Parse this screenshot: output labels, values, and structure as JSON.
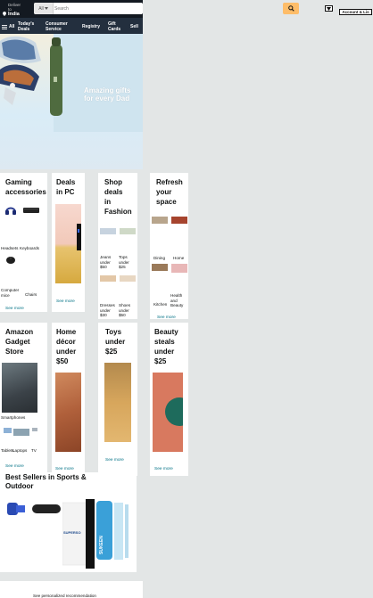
{
  "header": {
    "deliver_line1": "Deliver",
    "deliver_line2": "to",
    "location": "India",
    "search_category": "All",
    "search_placeholder": "Search",
    "account_label": "Account & Lis"
  },
  "nav": {
    "all_label": "All",
    "items": [
      {
        "line1": "Today's",
        "line2": "Deals"
      },
      {
        "line1": "Consumer",
        "line2": "Service"
      },
      {
        "line1": "Registry",
        "line2": ""
      },
      {
        "line1": "Gift",
        "line2": "Cards"
      },
      {
        "line1": "Sell",
        "line2": ""
      }
    ]
  },
  "hero": {
    "line1": "Amazing gifts",
    "line2": "for every Dad"
  },
  "cards": {
    "gaming": {
      "title_l1": "Gaming",
      "title_l2": "accessories",
      "items": [
        "Headsets",
        "Keyboards",
        "Computer mice",
        "Chairs"
      ],
      "see_more": "See more"
    },
    "deals_pc": {
      "title_l1": "Deals",
      "title_l2": "in PC",
      "see_more": "See more"
    },
    "fashion": {
      "title_l1": "Shop",
      "title_l2": "deals",
      "title_l3": "in",
      "title_l4": "Fashion",
      "items": [
        "Jeans under $50",
        "Tops under $25",
        "Dresses under $30",
        "Shoes under $50"
      ],
      "see_more": "See more"
    },
    "refresh": {
      "title_l1": "Refresh",
      "title_l2": "your",
      "title_l3": "space",
      "items": [
        "Dining",
        "Home",
        "Kitchen",
        "Health and Beauty"
      ],
      "see_more": "See more"
    },
    "gadget": {
      "title_l1": "Amazon",
      "title_l2": "Gadget",
      "title_l3": "Store",
      "items": [
        "Smartphones",
        "Tablets",
        "Laptops",
        "TV"
      ],
      "see_more": "See more"
    },
    "home_decor": {
      "title_l1": "Home",
      "title_l2": "décor",
      "title_l3": "under",
      "title_l4": "$50",
      "see_more": "See more"
    },
    "toys": {
      "title_l1": "Toys",
      "title_l2": "under",
      "title_l3": "$25",
      "see_more": "See more"
    },
    "beauty": {
      "title_l1": "Beauty",
      "title_l2": "steals",
      "title_l3": "under",
      "title_l4": "$25",
      "see_more": "See more"
    }
  },
  "best_sellers": {
    "title_l1": "Best Sellers in Sports &",
    "title_l2": "Outdoor",
    "bottle_brand": "SUKEEN",
    "tube_brand": "SUPERSO"
  },
  "footer": {
    "personalized": "See personalized recommendation"
  },
  "colors": {
    "topbar": "#131921",
    "navbar": "#232f3e",
    "search_button": "#febd69",
    "link": "#007185"
  }
}
